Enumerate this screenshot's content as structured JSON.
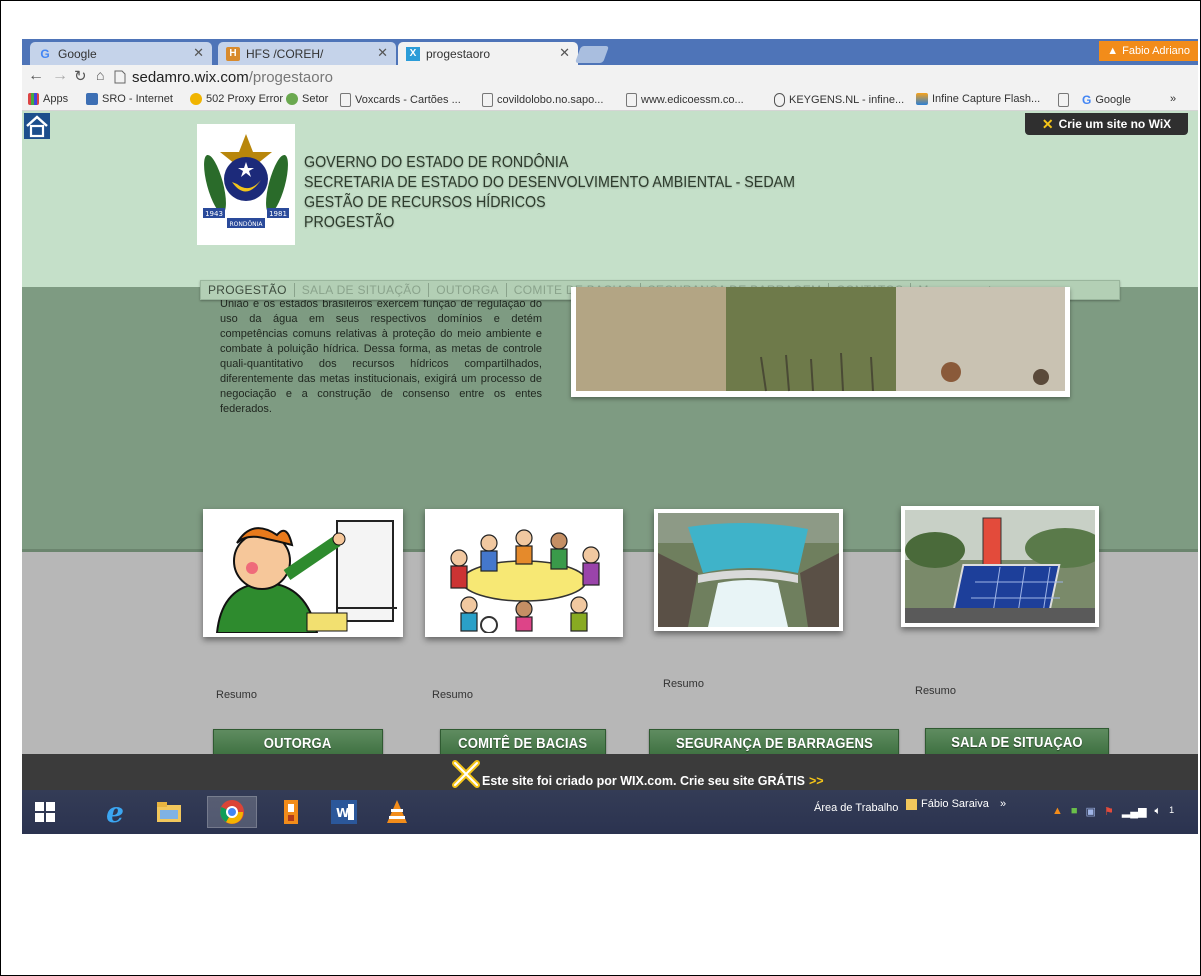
{
  "browser": {
    "tabs": [
      {
        "title": "Google",
        "active": false
      },
      {
        "title": "HFS /COREH/",
        "active": false
      },
      {
        "title": "progestaoro",
        "active": true
      }
    ],
    "profile_name": "Fabio Adriano",
    "url_host": "sedamro.wix.com",
    "url_path": "/progestaoro",
    "bookmarks": [
      "Apps",
      "SRO - Internet",
      "502 Proxy Error",
      "Setor",
      "Voxcards - Cartões ...",
      "covildolobo.no.sapo...",
      "www.edicoessm.co...",
      "KEYGENS.NL - infine...",
      "Infine Capture Flash...",
      "Google",
      "»"
    ]
  },
  "header": {
    "wix_cta": "Crie um site no WiX",
    "title_lines": [
      "GOVERNO DO ESTADO DE RONDÔNIA",
      "SECRETARIA DE ESTADO DO DESENVOLVIMENTO AMBIENTAL - SEDAM",
      "GESTÃO DE RECURSOS HÍDRICOS",
      "PROGESTÃO"
    ],
    "logo_years": [
      "1943",
      "1981"
    ],
    "logo_banner": "RONDÔNIA"
  },
  "menu": [
    "PROGESTÃO",
    "SALA DE SITUAÇÃO",
    "OUTORGA",
    "COMITE DE BACIAS",
    "SEGURANÇA DE BARRAGEM",
    "CONTATOS",
    "Menuprogest"
  ],
  "intro_text": "União e os estados brasileiros exercem função de regulação do uso da água em seus respectivos domínios e detém competências comuns relativas à proteção do meio ambiente e combate à poluição hídrica. Dessa forma, as metas de controle quali-quantitativo dos recursos hídricos compartilhados, diferentemente das metas institucionais, exigirá um processo de negociação e a construção de consenso entre os entes federados.",
  "cards": [
    {
      "caption": "Resumo",
      "image": "outorga-cartoon"
    },
    {
      "caption": "Resumo",
      "image": "comite-meeting-cartoon"
    },
    {
      "caption": "Resumo",
      "image": "dam-photo"
    },
    {
      "caption": "Resumo",
      "image": "monitoring-station-photo"
    }
  ],
  "buttons": [
    "OUTORGA",
    "COMITÊ DE BACIAS",
    "SEGURANÇA DE BARRAGENS",
    "SALA DE SITUAÇAO"
  ],
  "wix_banner": {
    "text": "Este site foi criado por WIX.com. Crie seu site GRÁTIS",
    "arrow": ">>"
  },
  "taskbar": {
    "desktop_label": "Área de Trabalho",
    "user_label": "Fábio Saraiva",
    "chevron": "»",
    "clock_fragment": "1"
  },
  "colors": {
    "header_bg": "#c5e0c9",
    "body_bg": "#7e9b82",
    "button_green": "#4a7c4c",
    "tabstrip": "#4e74b8"
  }
}
